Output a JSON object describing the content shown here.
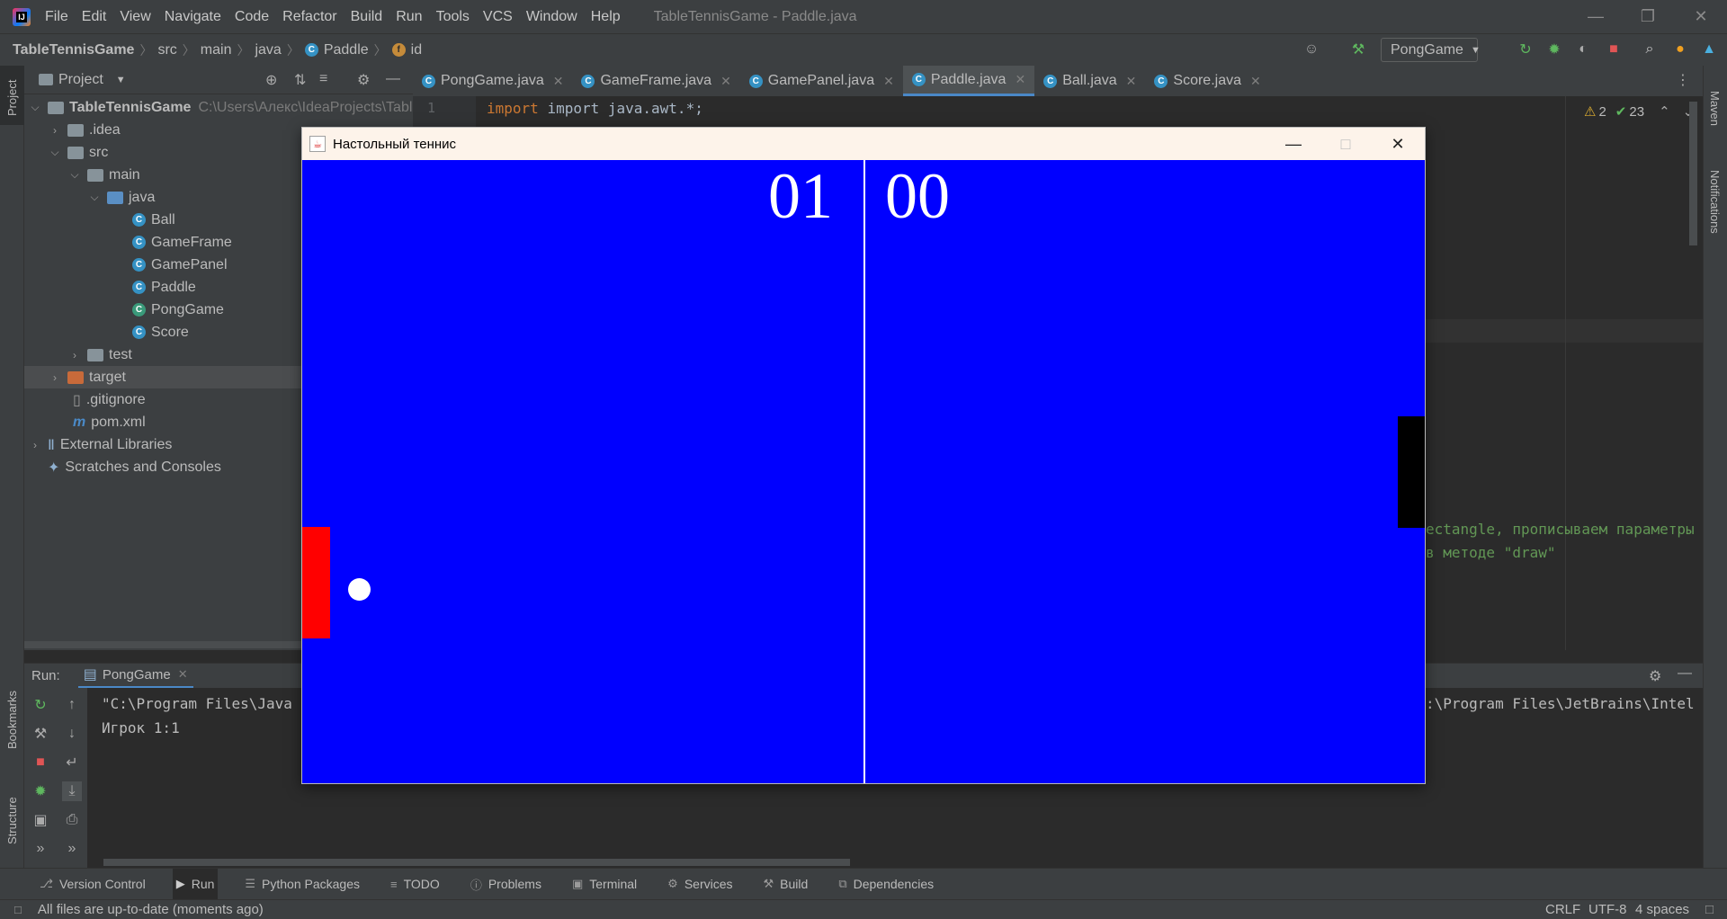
{
  "titlebar": {
    "menu": [
      "File",
      "Edit",
      "View",
      "Navigate",
      "Code",
      "Refactor",
      "Build",
      "Run",
      "Tools",
      "VCS",
      "Window",
      "Help"
    ],
    "window_title": "TableTennisGame - Paddle.java"
  },
  "navbar": {
    "crumbs": [
      "TableTennisGame",
      "src",
      "main",
      "java",
      "Paddle",
      "id"
    ],
    "run_config": "PongGame"
  },
  "project": {
    "header": "Project",
    "root_name": "TableTennisGame",
    "root_path": "C:\\Users\\Алекс\\IdeaProjects\\TableTe",
    "idea": ".idea",
    "src": "src",
    "main": "main",
    "java": "java",
    "classes": [
      "Ball",
      "GameFrame",
      "GamePanel",
      "Paddle",
      "PongGame",
      "Score"
    ],
    "test": "test",
    "target": "target",
    "gitignore": ".gitignore",
    "pom": "pom.xml",
    "external": "External Libraries",
    "scratches": "Scratches and Consoles"
  },
  "tabs": [
    "PongGame.java",
    "GameFrame.java",
    "GamePanel.java",
    "Paddle.java",
    "Ball.java",
    "Score.java"
  ],
  "editor": {
    "line_no": "1",
    "code_line1": "import java.awt.*;",
    "warnings": "2",
    "checks": "23",
    "snippet1": "ectangle, прописываем параметры",
    "snippet2": "в методе \"draw\""
  },
  "left_strip": {
    "project": "Project",
    "bookmarks": "Bookmarks",
    "structure": "Structure"
  },
  "right_strip": {
    "maven": "Maven",
    "notifications": "Notifications"
  },
  "run": {
    "label": "Run:",
    "tab": "PongGame",
    "line1_left": "\"C:\\Program Files\\Java",
    "line1_right": ":\\Program Files\\JetBrains\\Intel",
    "line2": "Игрок 1:1"
  },
  "bottom_tools": [
    "Version Control",
    "Run",
    "Python Packages",
    "TODO",
    "Problems",
    "Terminal",
    "Services",
    "Build",
    "Dependencies"
  ],
  "status": {
    "message": "All files are up-to-date (moments ago)",
    "line_sep": "CRLF",
    "encoding": "UTF-8",
    "indent": "4 spaces"
  },
  "game": {
    "title": "Настольный теннис",
    "score_left": "01",
    "score_right": "00",
    "colors": {
      "background": "#0000ff",
      "paddle_left": "#ff0000",
      "paddle_right": "#000000",
      "ball": "#ffffff"
    }
  }
}
